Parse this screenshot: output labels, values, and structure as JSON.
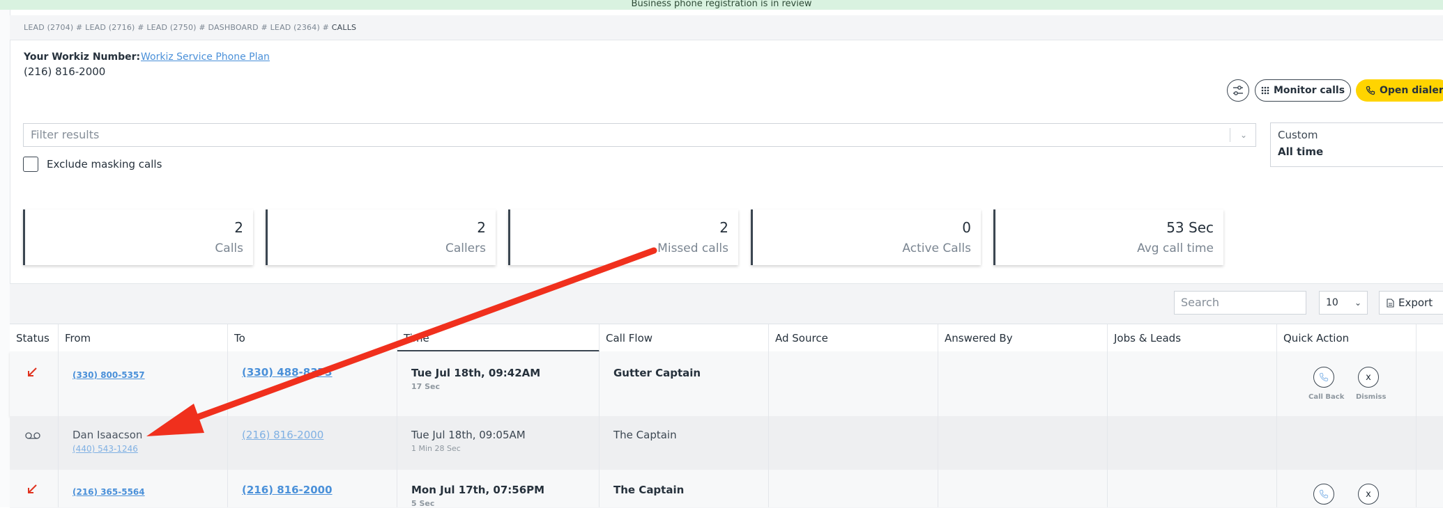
{
  "banner": {
    "text": "Business phone registration is in review"
  },
  "breadcrumb": {
    "trail": "LEAD (2704) # LEAD (2716) # LEAD (2750) # DASHBOARD # LEAD (2364) # ",
    "current": "CALLS"
  },
  "header": {
    "number_label": "Your Workiz Number:",
    "plan_link": "Workiz Service Phone Plan",
    "number": "(216) 816-2000"
  },
  "toolbar": {
    "monitor_label": "Monitor calls",
    "dialer_label": "Open dialer",
    "filter_icon": "filter-sliders-icon"
  },
  "filter": {
    "placeholder": "Filter results"
  },
  "date_range": {
    "mode": "Custom",
    "range": "All time"
  },
  "exclude_masking": {
    "label": "Exclude masking calls",
    "checked": false
  },
  "stats": [
    {
      "value": "2",
      "label": "Calls"
    },
    {
      "value": "2",
      "label": "Callers"
    },
    {
      "value": "2",
      "label": "Missed calls"
    },
    {
      "value": "0",
      "label": "Active Calls"
    },
    {
      "value": "53 Sec",
      "label": "Avg call time"
    }
  ],
  "table_controls": {
    "search_placeholder": "Search",
    "page_size": "10",
    "export_label": "Export"
  },
  "columns": [
    "Status",
    "From",
    "To",
    "Time",
    "Call Flow",
    "Ad Source",
    "Answered By",
    "Jobs & Leads",
    "Quick Action"
  ],
  "rows": [
    {
      "status": "missed",
      "from_name": "",
      "from_number": "(330) 800-5357",
      "to": "(330) 488-8373",
      "time": "Tue Jul 18th, 09:42AM",
      "duration": "17 Sec",
      "flow": "Gutter Captain",
      "quick_actions": [
        "Call Back",
        "Dismiss"
      ]
    },
    {
      "status": "voicemail",
      "from_name": "Dan Isaacson",
      "from_number": "(440) 543-1246",
      "to": "(216) 816-2000",
      "time": "Tue Jul 18th, 09:05AM",
      "duration": "1 Min 28 Sec",
      "flow": "The Captain",
      "quick_actions": []
    },
    {
      "status": "missed",
      "from_name": "",
      "from_number": "(216) 365-5564",
      "to": "(216) 816-2000",
      "time": "Mon Jul 17th, 07:56PM",
      "duration": "5 Sec",
      "flow": "The Captain",
      "quick_actions": [
        "Call Back",
        "Dismiss"
      ]
    }
  ],
  "colors": {
    "accent_yellow": "#ffd400",
    "link_blue": "#4a90d9",
    "banner_green": "#d9f2e0",
    "annotation_red": "#f0301d"
  }
}
